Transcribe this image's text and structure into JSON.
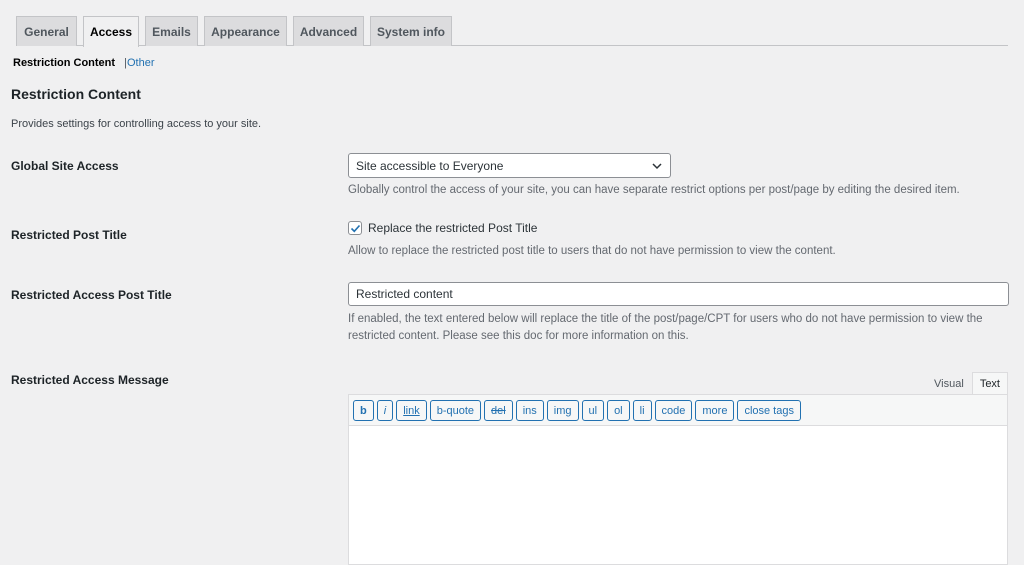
{
  "tabs": [
    {
      "label": "General",
      "active": false
    },
    {
      "label": "Access",
      "active": true
    },
    {
      "label": "Emails",
      "active": false
    },
    {
      "label": "Appearance",
      "active": false
    },
    {
      "label": "Advanced",
      "active": false
    },
    {
      "label": "System info",
      "active": false
    }
  ],
  "subnav": {
    "current": "Restriction Content",
    "separator": "|",
    "other": "Other"
  },
  "section": {
    "title": "Restriction Content",
    "intro": "Provides settings for controlling access to your site."
  },
  "fields": {
    "global_access": {
      "label": "Global Site Access",
      "selected": "Site accessible to Everyone",
      "description": "Globally control the access of your site, you can have separate restrict options per post/page by editing the desired item."
    },
    "restricted_post_title": {
      "label": "Restricted Post Title",
      "checkbox_label": "Replace the restricted Post Title",
      "checked": true,
      "description": "Allow to replace the restricted post title to users that do not have permission to view the content."
    },
    "restricted_access_post_title": {
      "label": "Restricted Access Post Title",
      "value": "Restricted content",
      "description_line1": "If enabled, the text entered below will replace the title of the post/page/CPT for users who do not have permission to view the",
      "description_line2": "restricted content. Please see this doc for more information on this."
    },
    "restricted_access_message": {
      "label": "Restricted Access Message",
      "editor_tabs": {
        "visual": "Visual",
        "text": "Text"
      },
      "toolbar": [
        "b",
        "i",
        "link",
        "b-quote",
        "del",
        "ins",
        "img",
        "ul",
        "ol",
        "li",
        "code",
        "more",
        "close tags"
      ]
    }
  },
  "colors": {
    "accent": "#2271b1",
    "background": "#f0f0f1"
  }
}
